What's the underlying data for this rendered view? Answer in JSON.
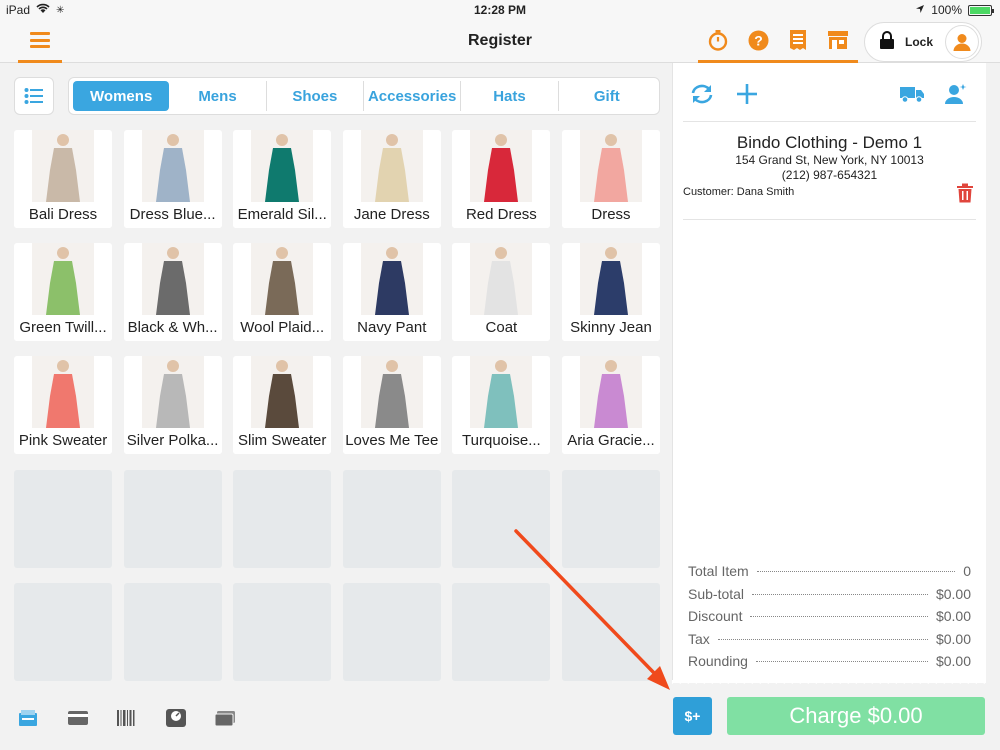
{
  "status_bar": {
    "device": "iPad",
    "time": "12:28 PM",
    "battery": "100%",
    "battery_level": 1.0
  },
  "nav": {
    "title": "Register",
    "lock_label": "Lock",
    "accent_color": "#f08a1c"
  },
  "categories": [
    {
      "label": "Womens",
      "active": true
    },
    {
      "label": "Mens",
      "active": false
    },
    {
      "label": "Shoes",
      "active": false
    },
    {
      "label": "Accessories",
      "active": false
    },
    {
      "label": "Hats",
      "active": false
    },
    {
      "label": "Gift",
      "active": false
    }
  ],
  "products": [
    {
      "name": "Bali Dress",
      "color": "#c9b9a8"
    },
    {
      "name": "Dress Blue...",
      "color": "#9fb3c8"
    },
    {
      "name": "Emerald Sil...",
      "color": "#0f7a6e"
    },
    {
      "name": "Jane Dress",
      "color": "#e2d3b0"
    },
    {
      "name": "Red Dress",
      "color": "#d8283a"
    },
    {
      "name": "Dress",
      "color": "#f2a7a0"
    },
    {
      "name": "Green Twill...",
      "color": "#8cc06a"
    },
    {
      "name": "Black & Wh...",
      "color": "#6b6b6b"
    },
    {
      "name": "Wool Plaid...",
      "color": "#7a6a58"
    },
    {
      "name": "Navy Pant",
      "color": "#2d3a63"
    },
    {
      "name": "Coat",
      "color": "#e3e3e3"
    },
    {
      "name": "Skinny Jean",
      "color": "#2c3d6a"
    },
    {
      "name": "Pink Sweater",
      "color": "#f0786e"
    },
    {
      "name": "Silver Polka...",
      "color": "#b8b8b8"
    },
    {
      "name": "Slim Sweater",
      "color": "#5a4a3c"
    },
    {
      "name": "Loves Me Tee",
      "color": "#8a8a8a"
    },
    {
      "name": "Turquoise...",
      "color": "#7fc0bd"
    },
    {
      "name": "Aria Gracie...",
      "color": "#c98ad2"
    }
  ],
  "store": {
    "name": "Bindo Clothing - Demo 1",
    "address": "154 Grand St, New York, NY 10013",
    "phone": "(212) 987-654321",
    "customer": "Customer: Dana Smith"
  },
  "totals": [
    {
      "label": "Total Item",
      "value": "0"
    },
    {
      "label": "Sub-total",
      "value": "$0.00"
    },
    {
      "label": "Discount",
      "value": "$0.00"
    },
    {
      "label": "Tax",
      "value": "$0.00"
    },
    {
      "label": "Rounding",
      "value": "$0.00"
    }
  ],
  "actions": {
    "add_money_label": "$+",
    "charge_label": "Charge $0.00"
  },
  "colors": {
    "blue": "#3aa6e0",
    "orange": "#f08a1c",
    "green_disabled": "#80e0a3",
    "trash_red": "#e0453c",
    "arrow_red": "#f04a1c"
  }
}
